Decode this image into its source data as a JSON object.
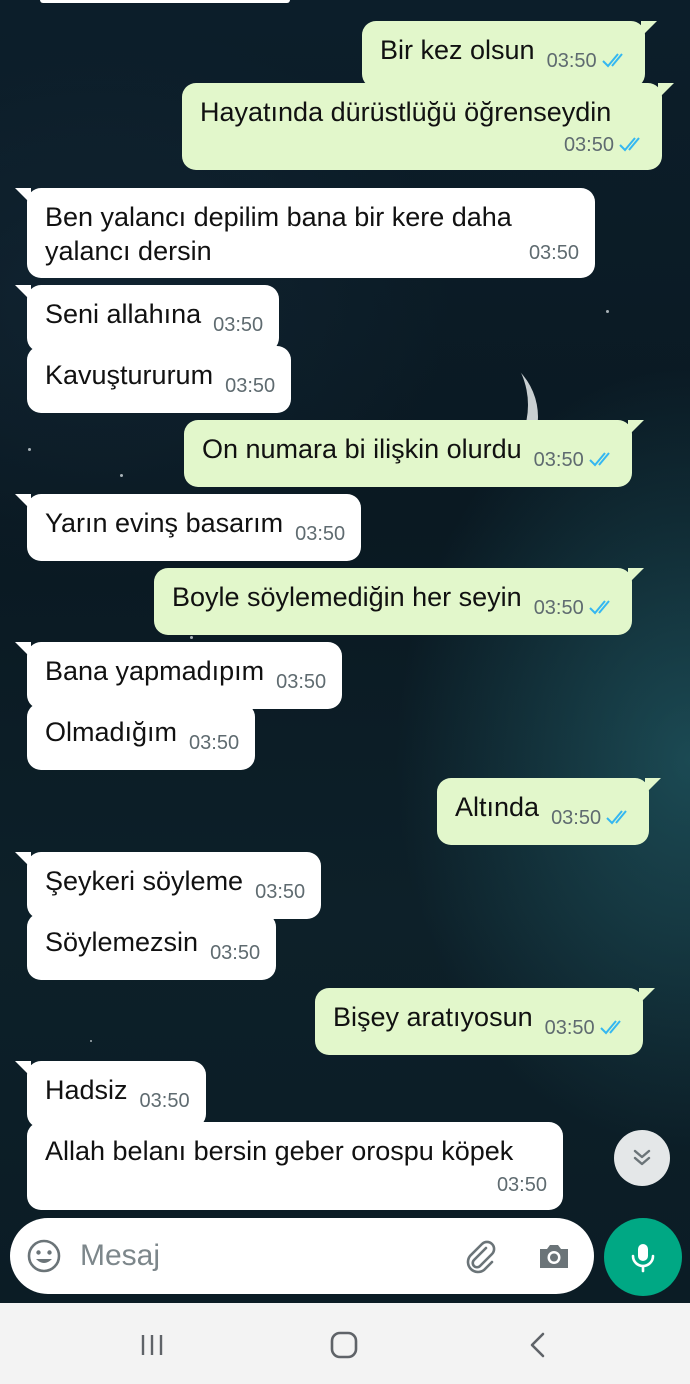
{
  "colors": {
    "outgoing_bubble": "#e2f7cb",
    "incoming_bubble": "#ffffff",
    "read_ticks": "#34b7f1",
    "accent_green": "#00a884",
    "timestamp": "#5f6b70"
  },
  "messages": [
    {
      "direction": "out",
      "text": "Bir kez olsun",
      "time": "03:50",
      "status": "read"
    },
    {
      "direction": "out",
      "text": "Hayatında dürüstlüğü öğrenseydin",
      "time": "03:50",
      "status": "read"
    },
    {
      "direction": "in",
      "text": "Ben yalancı depilim bana bir kere daha yalancı dersin",
      "time": "03:50"
    },
    {
      "direction": "in",
      "text": "Seni allahına",
      "time": "03:50"
    },
    {
      "direction": "in",
      "text": "Kavuştururum",
      "time": "03:50"
    },
    {
      "direction": "out",
      "text": "On numara bi ilişkin olurdu",
      "time": "03:50",
      "status": "read"
    },
    {
      "direction": "in",
      "text": "Yarın evinş basarım",
      "time": "03:50"
    },
    {
      "direction": "out",
      "text": "Boyle söylemediğin her seyin",
      "time": "03:50",
      "status": "read"
    },
    {
      "direction": "in",
      "text": "Bana yapmadıpım",
      "time": "03:50"
    },
    {
      "direction": "in",
      "text": "Olmadığım",
      "time": "03:50"
    },
    {
      "direction": "out",
      "text": "Altında",
      "time": "03:50",
      "status": "read"
    },
    {
      "direction": "in",
      "text": "Şeykeri söyleme",
      "time": "03:50"
    },
    {
      "direction": "in",
      "text": "Söylemezsin",
      "time": "03:50"
    },
    {
      "direction": "out",
      "text": "Bişey aratıyosun",
      "time": "03:50",
      "status": "read"
    },
    {
      "direction": "in",
      "text": "Hadsiz",
      "time": "03:50"
    },
    {
      "direction": "in",
      "text": "Allah belanı bersin geber orospu köpek",
      "time": "03:50"
    }
  ],
  "composer": {
    "placeholder": "Mesaj",
    "emoji_icon": "emoji-icon",
    "attach_icon": "paperclip-icon",
    "camera_icon": "camera-icon",
    "mic_icon": "microphone-icon"
  },
  "scroll_down_icon": "double-chevron-down-icon",
  "navbar": {
    "recent_icon": "recent-apps-icon",
    "home_icon": "home-icon",
    "back_icon": "back-icon"
  }
}
